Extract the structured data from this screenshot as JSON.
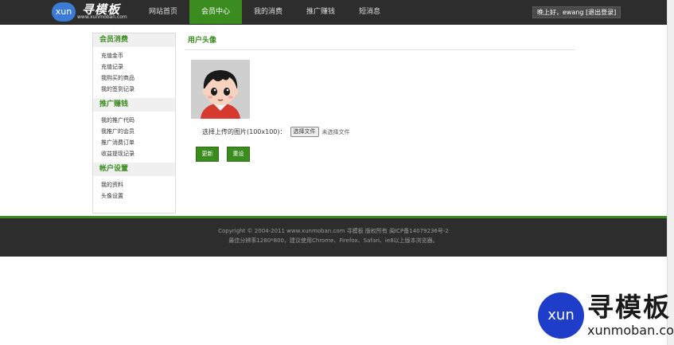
{
  "header": {
    "logo_badge": "xun",
    "logo_name": "寻模板",
    "logo_url": "www.xunmoban.com",
    "nav": [
      {
        "label": "网站首页",
        "active": false
      },
      {
        "label": "会员中心",
        "active": true
      },
      {
        "label": "我的消费",
        "active": false
      },
      {
        "label": "推广赚钱",
        "active": false
      },
      {
        "label": "短消息",
        "active": false
      }
    ],
    "greeting": "晚上好，ewang",
    "logout": "[退出登录]"
  },
  "sidebar": {
    "sections": [
      {
        "title": "会员消费",
        "items": [
          "充值金币",
          "充值记录",
          "我购买的商品",
          "我的签到记录"
        ]
      },
      {
        "title": "推广赚钱",
        "items": [
          "我的推广代码",
          "我推广的会员",
          "推广消费订单",
          "收益提现记录"
        ]
      },
      {
        "title": "帐户设置",
        "items": [
          "我的资料",
          "头像设置"
        ]
      }
    ]
  },
  "main": {
    "title": "用户头像",
    "upload_label": "选择上传的图片(100x100)：",
    "choose_button": "选择文件",
    "no_file": "未选择文件",
    "update_button": "更新",
    "reset_button": "重设"
  },
  "footer": {
    "line1": "Copyright © 2004-2011 www.xunmoban.com  寻模板  版权所有 闽ICP备14079236号-2",
    "line2": "最佳分辨率1280*800，建议使用Chrome、Firefox、Safari、ie8以上版本浏览器。"
  },
  "watermark": {
    "badge": "xun",
    "name": "寻模板",
    "url": "xunmoban.com"
  },
  "colors": {
    "accent": "#3b8c1e",
    "header_bg": "#2d2d2d",
    "watermark_blue": "#1e3ec9"
  }
}
